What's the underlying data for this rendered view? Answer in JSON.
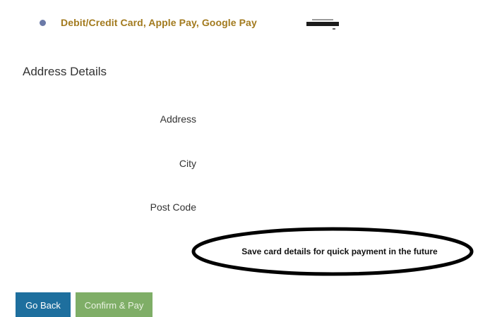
{
  "payment": {
    "selected_option": "Debit/Credit Card, Apple Pay, Google Pay",
    "logos_icon": "card-logos-strip"
  },
  "address_section": {
    "title": "Address Details",
    "fields": {
      "address_label": "Address",
      "city_label": "City",
      "postcode_label": "Post Code"
    }
  },
  "save_card": {
    "label": "Save card details for quick payment in the future"
  },
  "buttons": {
    "back_label": "Go Back",
    "confirm_label": "Confirm & Pay"
  },
  "colors": {
    "payment_label": "#a27a1e",
    "radio_dot": "#6b7aa8",
    "back_button": "#1e6f9e",
    "confirm_button": "#7fae67",
    "annotation_ellipse": "#000000"
  }
}
